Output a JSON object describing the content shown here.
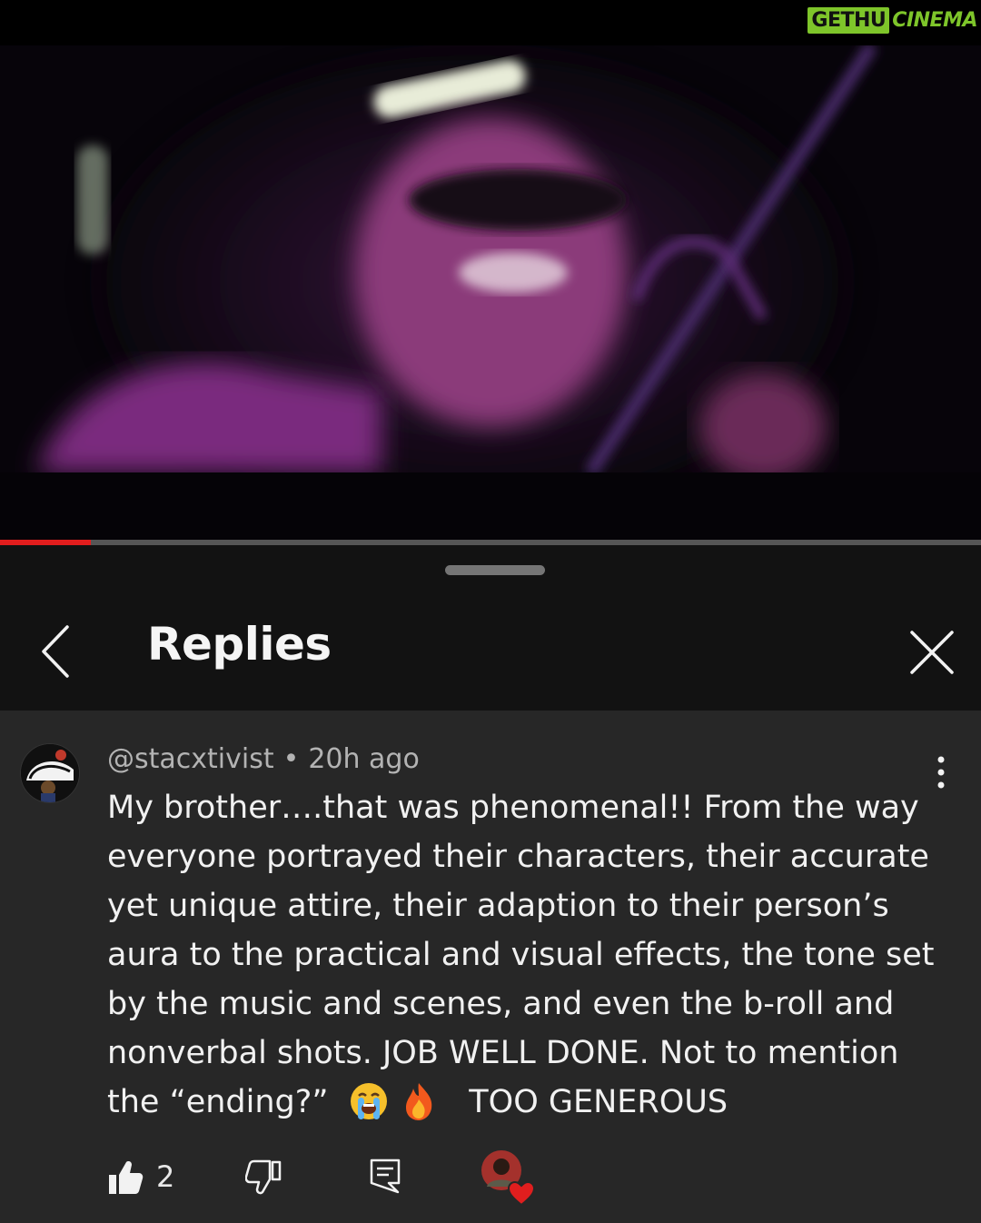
{
  "watermark": {
    "part1": "GETHU",
    "part2": "CINEMA"
  },
  "video": {
    "progress_percent": 9.3
  },
  "sheet": {
    "title": "Replies"
  },
  "comment": {
    "author": "@stacxtivist",
    "separator": "•",
    "time": "20h ago",
    "lines": [
      "My brother….that was phenomenal!! From the way",
      "everyone portrayed their characters, their accurate",
      "yet unique attire, their adaption to their person’s",
      "aura to the practical and visual effects, the tone set",
      "by the music and scenes, and even the b-roll and",
      "nonverbal shots. JOB WELL DONE. Not to mention"
    ],
    "last_line_start": "the “ending?” ",
    "last_line_end": "TOO GENEROUS",
    "emojis": [
      "loudly-crying-face-icon",
      "fire-icon"
    ],
    "like_count": "2"
  },
  "colors": {
    "accent_red": "#e11d1d",
    "sheet_bg": "#272727",
    "header_bg": "#121212",
    "watermark_green": "#7ec52a"
  }
}
